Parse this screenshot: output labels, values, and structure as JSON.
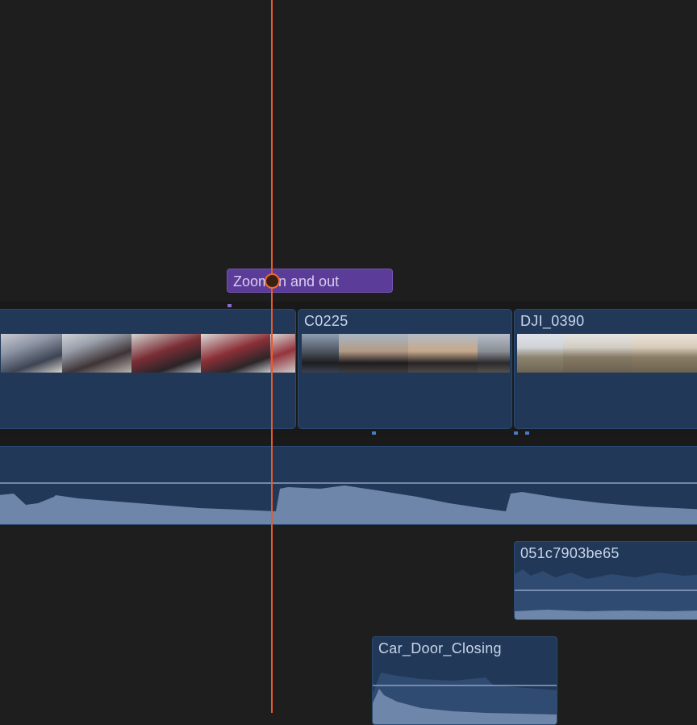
{
  "timeline": {
    "title_clip": {
      "label": "Zoom In and out"
    },
    "video_clips": [
      {
        "name": ""
      },
      {
        "name": "C0225"
      },
      {
        "name": "DJI_0390"
      }
    ],
    "audio_clips": [
      {
        "name": "051c7903be65"
      },
      {
        "name": "Car_Door_Closing"
      }
    ]
  },
  "colors": {
    "clip_fill": "#213858",
    "title_fill": "#5b3c98",
    "playhead": "#e85a2a",
    "waveform": "#6f86ab"
  }
}
